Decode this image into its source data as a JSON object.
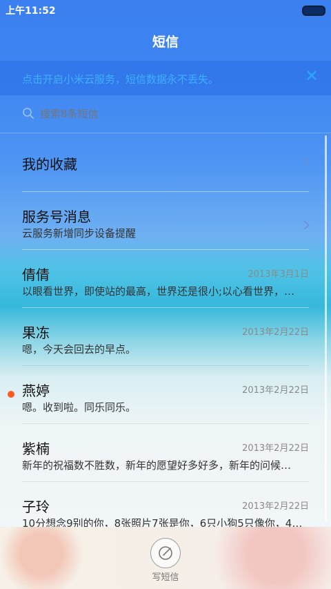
{
  "status": {
    "time": "上午11:52"
  },
  "header": {
    "title": "短信"
  },
  "banner": {
    "text": "点击开启小米云服务，短信数据永不丢失。"
  },
  "search": {
    "placeholder": "搜索8条短信"
  },
  "list": {
    "items": [
      {
        "name": "我的收藏",
        "preview": "",
        "date": "",
        "chevron": true,
        "unread": false
      },
      {
        "name": "服务号消息",
        "preview": "云服务新增同步设备提醒",
        "date": "",
        "chevron": true,
        "unread": false
      },
      {
        "name": "倩倩",
        "preview": "以眼看世界，即使站的最高，世界还是很小;以心看世界，…",
        "date": "2013年3月1日",
        "chevron": false,
        "unread": false
      },
      {
        "name": "果冻",
        "preview": "嗯，今天会回去的早点。",
        "date": "2013年2月22日",
        "chevron": false,
        "unread": false
      },
      {
        "name": "燕婷",
        "preview": "嗯。收到啦。同乐同乐。",
        "date": "2013年2月22日",
        "chevron": false,
        "unread": true
      },
      {
        "name": "紫楠",
        "preview": "新年的祝福数不胜数，新年的愿望好多好多，新年的问候…",
        "date": "2013年2月22日",
        "chevron": false,
        "unread": false
      },
      {
        "name": "子玲",
        "preview": "10分想念9别的你，8张照片7张是你，6只小狗5只像你，4…",
        "date": "2013年2月22日",
        "chevron": false,
        "unread": false
      }
    ]
  },
  "bottom": {
    "compose_label": "写短信"
  },
  "colors": {
    "accent": "#3fb0ff",
    "unread_dot": "#ff5a1f"
  },
  "icons": {
    "search": "search-icon",
    "close": "close-icon",
    "chevron": "chevron-right-icon",
    "compose": "compose-icon",
    "battery": "battery-icon"
  }
}
